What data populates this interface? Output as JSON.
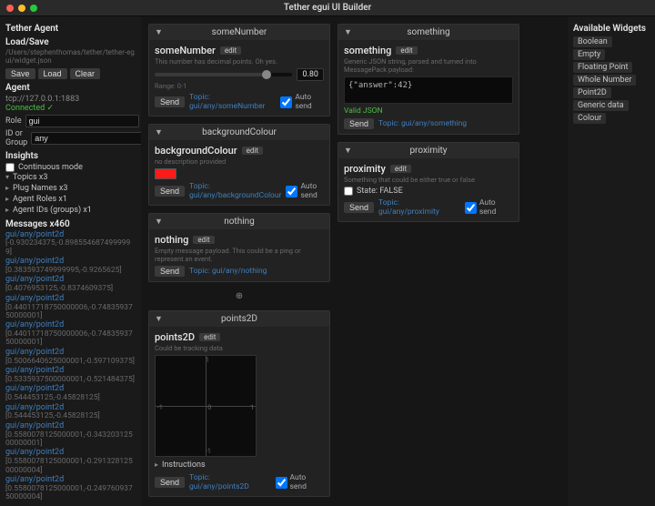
{
  "window": {
    "title": "Tether egui UI Builder"
  },
  "sidebar": {
    "agent_title": "Tether Agent",
    "loadsave_title": "Load/Save",
    "filepath": "/Users/stephenthomas/tether/tether-egui/widget.json",
    "save": "Save",
    "load": "Load",
    "clear": "Clear",
    "agent_heading": "Agent",
    "tcp": "tcp://127.0.0.1:1883",
    "connected": "Connected ✓",
    "role_label": "Role",
    "role_value": "gui",
    "group_label": "ID or Group",
    "group_value": "any",
    "insights_title": "Insights",
    "continuous": "Continuous mode",
    "topics": "Topics x3",
    "plugnames": "Plug Names x3",
    "agentroles": "Agent Roles x1",
    "agentids": "Agent IDs (groups) x1",
    "messages_title": "Messages x460",
    "msgs": [
      {
        "t": "gui/any/point2d",
        "v": "[-0.930234375,-0.8985546874999999]"
      },
      {
        "t": "gui/any/point2d",
        "v": "[0.383593749999995,-0.9265625]"
      },
      {
        "t": "gui/any/point2d",
        "v": "[0.4076953125,-0.8374609375]"
      },
      {
        "t": "gui/any/point2d",
        "v": "[0.44011718750000006,-0.7483593750000001]"
      },
      {
        "t": "gui/any/point2d",
        "v": "[0.44011718750000006,-0.7483593750000001]"
      },
      {
        "t": "gui/any/point2d",
        "v": "[0.5006640625000001,-0.597109375]"
      },
      {
        "t": "gui/any/point2d",
        "v": "[0.5335937500000001,-0.521484375]"
      },
      {
        "t": "gui/any/point2d",
        "v": "[0.544453125,-0.45828125]"
      },
      {
        "t": "gui/any/point2d",
        "v": "[0.544453125,-0.45828125]"
      },
      {
        "t": "gui/any/point2d",
        "v": "[0.5580078125000001,-0.34320312500000001]"
      },
      {
        "t": "gui/any/point2d",
        "v": "[0.5580078125000001,-0.29132812500000004]"
      },
      {
        "t": "gui/any/point2d",
        "v": "[0.5580078125000001,-0.24976093750000004]"
      }
    ]
  },
  "panels": {
    "someNumber": {
      "title": "someNumber",
      "name": "someNumber",
      "edit": "edit",
      "desc": "This number has decimal points. Oh yes.",
      "value": "0.80",
      "range": "Range: 0-1",
      "send": "Send",
      "topic": "Topic: gui/any/someNumber",
      "auto": "Auto send"
    },
    "backgroundColour": {
      "title": "backgroundColour",
      "name": "backgroundColour",
      "edit": "edit",
      "desc": "no description provided",
      "send": "Send",
      "topic": "Topic: gui/any/backgroundColour",
      "auto": "Auto send"
    },
    "nothing": {
      "title": "nothing",
      "name": "nothing",
      "edit": "edit",
      "desc": "Empty message payload. This could be a ping or represent an event.",
      "send": "Send",
      "topic": "Topic: gui/any/nothing"
    },
    "points2D": {
      "title": "points2D",
      "name": "points2D",
      "edit": "edit",
      "desc": "Could be tracking data",
      "instructions": "Instructions",
      "send": "Send",
      "topic": "Topic: gui/any/points2D",
      "auto": "Auto send"
    },
    "something": {
      "title": "something",
      "name": "something",
      "edit": "edit",
      "desc": "Generic JSON string, parsed and turned into MessagePack payload:",
      "json": "{\"answer\":42}",
      "valid": "Valid JSON",
      "send": "Send",
      "topic": "Topic: gui/any/something"
    },
    "proximity": {
      "title": "proximity",
      "name": "proximity",
      "edit": "edit",
      "desc": "Something that could be either true or false",
      "state": "State: FALSE",
      "send": "Send",
      "topic": "Topic: gui/any/proximity",
      "auto": "Auto send"
    }
  },
  "available": {
    "title": "Available Widgets",
    "items": [
      "Boolean",
      "Empty",
      "Floating Point",
      "Whole Number",
      "Point2D",
      "Generic data",
      "Colour"
    ]
  }
}
